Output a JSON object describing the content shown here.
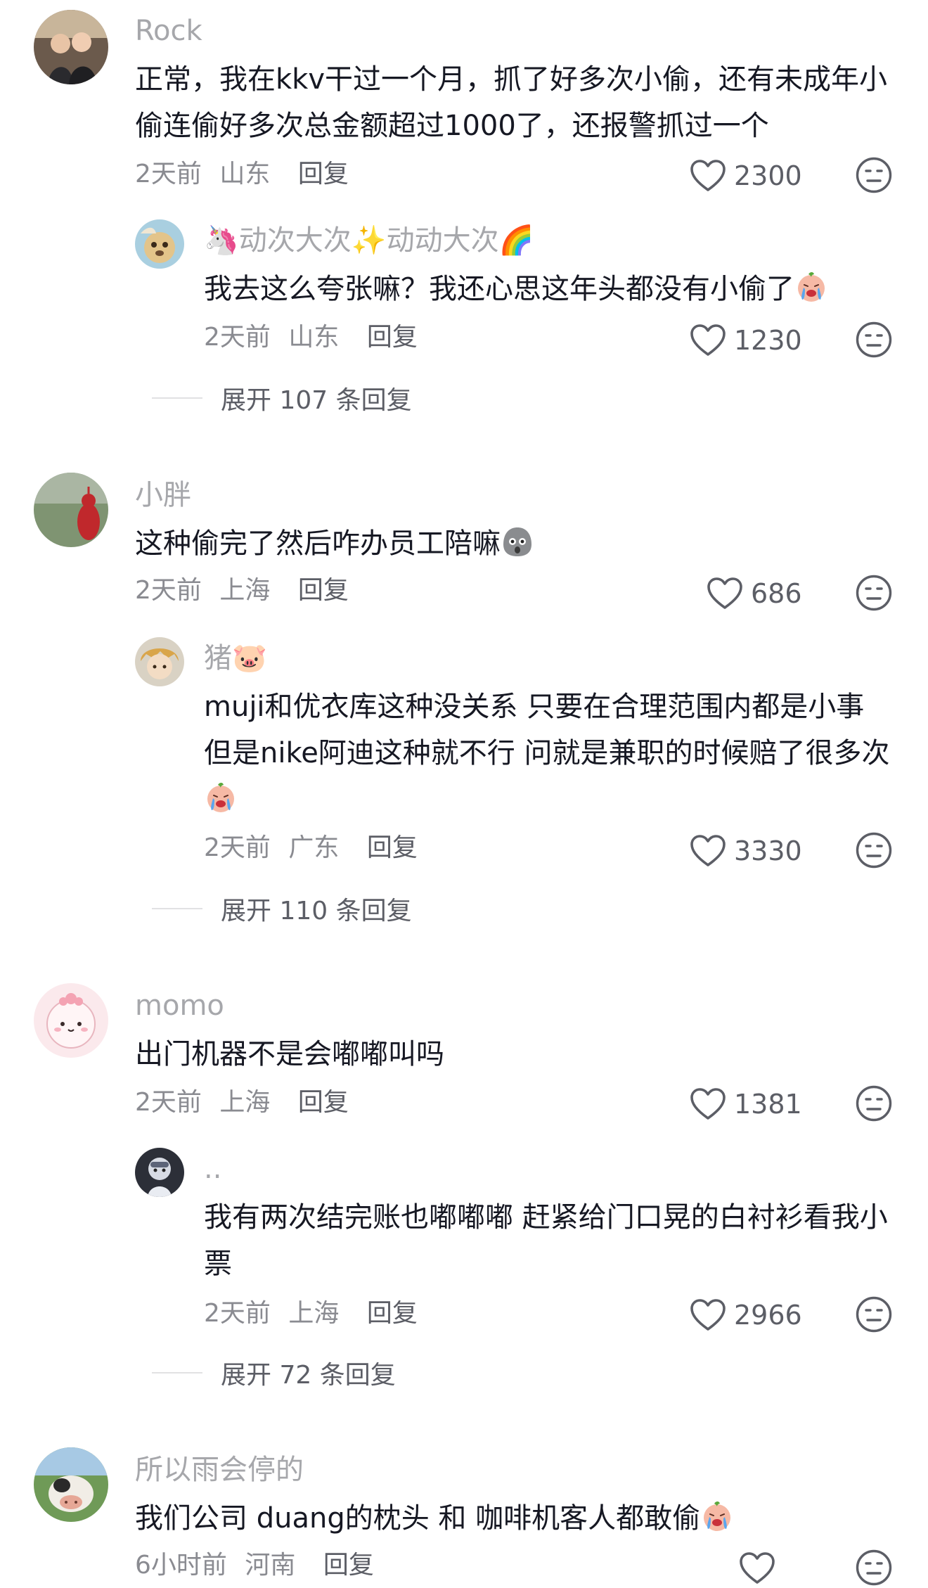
{
  "comments": [
    {
      "user": "Rock",
      "text": "正常，我在kkv干过一个月，抓了好多次小偷，还有未成年小偷连偷好多次总金额超过1000了，还报警抓过一个",
      "time": "2天前",
      "location": "山东",
      "reply_label": "回复",
      "likes": "2300",
      "reply": {
        "user": "🦄动次大次✨动动大次🌈",
        "text": "我去这么夸张嘛？我还心思这年头都没有小偷了",
        "emoji": "crying-face",
        "time": "2天前",
        "location": "山东",
        "reply_label": "回复",
        "likes": "1230"
      },
      "expand": "展开 107 条回复"
    },
    {
      "user": "小胖",
      "text": "这种偷完了然后咋办员工陪嘛",
      "emoji": "shocked-face",
      "time": "2天前",
      "location": "上海",
      "reply_label": "回复",
      "likes": "686",
      "reply": {
        "user": "猪🐷",
        "text": "muji和优衣库这种没关系 只要在合理范围内都是小事 但是nike阿迪这种就不行 问就是兼职的时候赔了很多次",
        "emoji": "crying-face",
        "time": "2天前",
        "location": "广东",
        "reply_label": "回复",
        "likes": "3330"
      },
      "expand": "展开 110 条回复"
    },
    {
      "user": "momo",
      "text": "出门机器不是会嘟嘟叫吗",
      "time": "2天前",
      "location": "上海",
      "reply_label": "回复",
      "likes": "1381",
      "reply": {
        "user": "..",
        "text": "我有两次结完账也嘟嘟嘟 赶紧给门口晃的白衬衫看我小票",
        "time": "2天前",
        "location": "上海",
        "reply_label": "回复",
        "likes": "2966"
      },
      "expand": "展开 72 条回复"
    },
    {
      "user": "所以雨会停的",
      "text": "我们公司 duang的枕头 和 咖啡机客人都敢偷",
      "emoji": "crying-face",
      "time": "6小时前",
      "location": "河南",
      "reply_label": "回复"
    }
  ],
  "colors": {
    "text": "#161823",
    "secondary": "#a6a7ab",
    "meta": "#8a8b91",
    "action": "#5c5e66"
  }
}
